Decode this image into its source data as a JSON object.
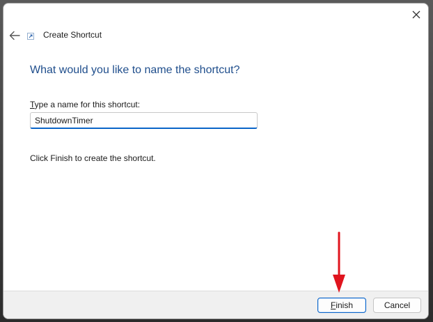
{
  "dialog": {
    "title": "Create Shortcut",
    "question": "What would you like to name the shortcut?",
    "field_label_accel": "T",
    "field_label_rest": "ype a name for this shortcut:",
    "name_value": "ShutdownTimer",
    "instruction": "Click Finish to create the shortcut."
  },
  "buttons": {
    "finish_accel": "F",
    "finish_rest": "inish",
    "cancel": "Cancel"
  },
  "icons": {
    "close": "close-icon",
    "back": "back-arrow-icon",
    "shortcut": "shortcut-icon",
    "annotation": "red-arrow-annotation"
  },
  "colors": {
    "accent": "#0a64c8",
    "question_text": "#1f4e8c",
    "annotation": "#e0141e"
  }
}
